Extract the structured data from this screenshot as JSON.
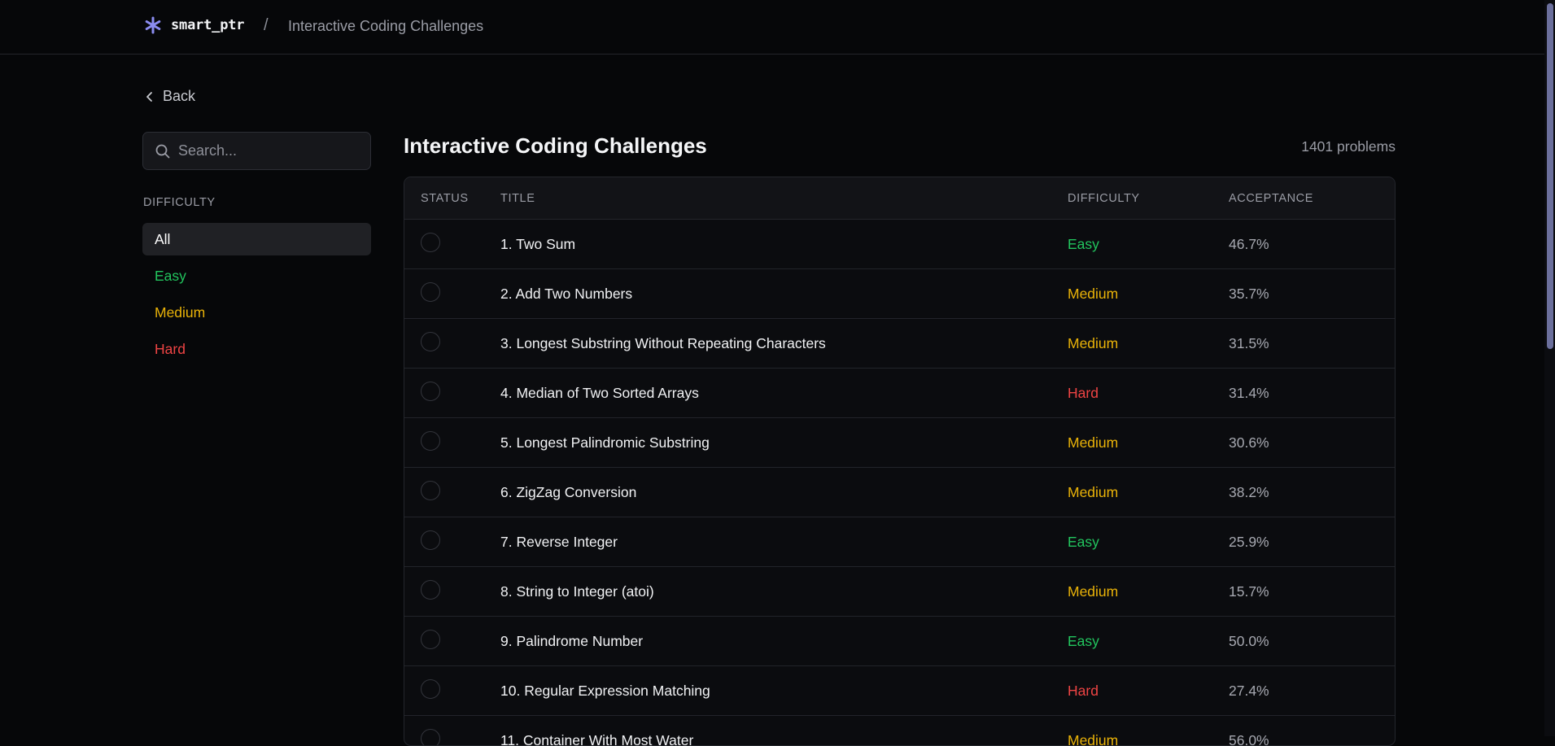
{
  "header": {
    "brand": "smart_ptr",
    "separator": "/",
    "breadcrumb": "Interactive Coding Challenges"
  },
  "sidebar": {
    "back_label": "Back",
    "search_placeholder": "Search...",
    "difficulty_heading": "DIFFICULTY",
    "filters": [
      {
        "label": "All",
        "active": true
      },
      {
        "label": "Easy",
        "active": false
      },
      {
        "label": "Medium",
        "active": false
      },
      {
        "label": "Hard",
        "active": false
      }
    ]
  },
  "main": {
    "title": "Interactive Coding Challenges",
    "count": "1401 problems",
    "columns": [
      "STATUS",
      "TITLE",
      "DIFFICULTY",
      "ACCEPTANCE"
    ],
    "rows": [
      {
        "title": "1. Two Sum",
        "difficulty": "Easy",
        "acceptance": "46.7%"
      },
      {
        "title": "2. Add Two Numbers",
        "difficulty": "Medium",
        "acceptance": "35.7%"
      },
      {
        "title": "3. Longest Substring Without Repeating Characters",
        "difficulty": "Medium",
        "acceptance": "31.5%"
      },
      {
        "title": "4. Median of Two Sorted Arrays",
        "difficulty": "Hard",
        "acceptance": "31.4%"
      },
      {
        "title": "5. Longest Palindromic Substring",
        "difficulty": "Medium",
        "acceptance": "30.6%"
      },
      {
        "title": "6. ZigZag Conversion",
        "difficulty": "Medium",
        "acceptance": "38.2%"
      },
      {
        "title": "7. Reverse Integer",
        "difficulty": "Easy",
        "acceptance": "25.9%"
      },
      {
        "title": "8. String to Integer (atoi)",
        "difficulty": "Medium",
        "acceptance": "15.7%"
      },
      {
        "title": "9. Palindrome Number",
        "difficulty": "Easy",
        "acceptance": "50.0%"
      },
      {
        "title": "10. Regular Expression Matching",
        "difficulty": "Hard",
        "acceptance": "27.4%"
      },
      {
        "title": "11. Container With Most Water",
        "difficulty": "Medium",
        "acceptance": "56.0%"
      }
    ]
  },
  "colors": {
    "easy": "#22c55e",
    "medium": "#eab308",
    "hard": "#ef4444",
    "brand_icon": "#8b8cf0"
  },
  "icons": {
    "brand": "asterisk-icon",
    "back": "chevron-left-icon",
    "search": "search-icon",
    "status": "circle-outline-icon"
  }
}
